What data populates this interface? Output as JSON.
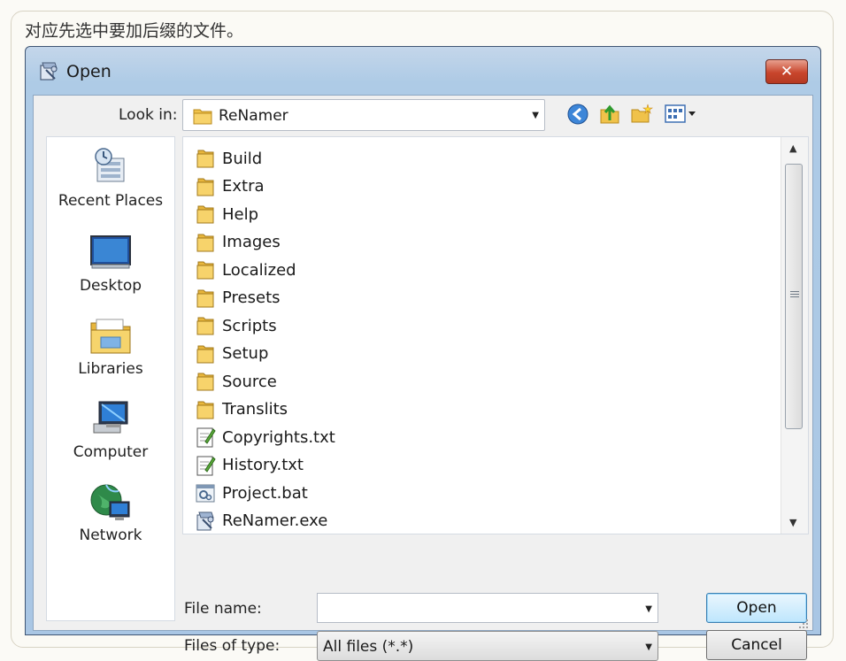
{
  "caption": "对应先选中要加后缀的文件。",
  "dialog": {
    "title": "Open",
    "close_label": "✕"
  },
  "toolbar": {
    "look_in_label": "Look in:",
    "look_in_value": "ReNamer",
    "icons": [
      "back-icon",
      "up-folder-icon",
      "new-folder-icon",
      "view-menu-icon"
    ]
  },
  "places": [
    {
      "label": "Recent Places",
      "icon": "recent-places-icon"
    },
    {
      "label": "Desktop",
      "icon": "desktop-icon"
    },
    {
      "label": "Libraries",
      "icon": "libraries-icon"
    },
    {
      "label": "Computer",
      "icon": "computer-icon"
    },
    {
      "label": "Network",
      "icon": "network-icon"
    }
  ],
  "files": [
    {
      "name": "Build",
      "type": "folder"
    },
    {
      "name": "Extra",
      "type": "folder"
    },
    {
      "name": "Help",
      "type": "folder"
    },
    {
      "name": "Images",
      "type": "folder"
    },
    {
      "name": "Localized",
      "type": "folder"
    },
    {
      "name": "Presets",
      "type": "folder"
    },
    {
      "name": "Scripts",
      "type": "folder"
    },
    {
      "name": "Setup",
      "type": "folder"
    },
    {
      "name": "Source",
      "type": "folder"
    },
    {
      "name": "Translits",
      "type": "folder"
    },
    {
      "name": "Copyrights.txt",
      "type": "text"
    },
    {
      "name": "History.txt",
      "type": "text"
    },
    {
      "name": "Project.bat",
      "type": "bat"
    },
    {
      "name": "ReNamer.exe",
      "type": "exe"
    }
  ],
  "form": {
    "file_name_label": "File name:",
    "file_name_value": "",
    "files_of_type_label": "Files of type:",
    "files_of_type_value": "All files (*.*)",
    "open_label": "Open",
    "cancel_label": "Cancel"
  },
  "colors": {
    "title_bar": "#aecbe6",
    "close_button": "#c8452c",
    "folder": "#f0c24a",
    "open_button_border": "#3c7fb1"
  }
}
